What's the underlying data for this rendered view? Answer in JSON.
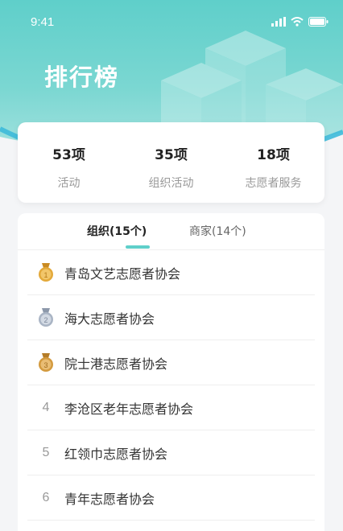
{
  "status_bar": {
    "time": "9:41"
  },
  "header": {
    "title": "排行榜"
  },
  "stats": [
    {
      "value": "53项",
      "label": "活动"
    },
    {
      "value": "35项",
      "label": "组织活动"
    },
    {
      "value": "18项",
      "label": "志愿者服务"
    }
  ],
  "tabs": [
    {
      "label": "组织(15个)",
      "active": true
    },
    {
      "label": "商家(14个)",
      "active": false
    }
  ],
  "ranking": [
    {
      "rank": "1",
      "medal": "gold",
      "name": "青岛文艺志愿者协会"
    },
    {
      "rank": "2",
      "medal": "silver",
      "name": "海大志愿者协会"
    },
    {
      "rank": "3",
      "medal": "bronze",
      "name": "院士港志愿者协会"
    },
    {
      "rank": "4",
      "name": "李沧区老年志愿者协会"
    },
    {
      "rank": "5",
      "name": "红领巾志愿者协会"
    },
    {
      "rank": "6",
      "name": "青年志愿者协会"
    }
  ],
  "colors": {
    "accent": "#5fcfca",
    "gold": "#e3a93a",
    "silver": "#a9b4c4",
    "bronze": "#d39a3e"
  }
}
